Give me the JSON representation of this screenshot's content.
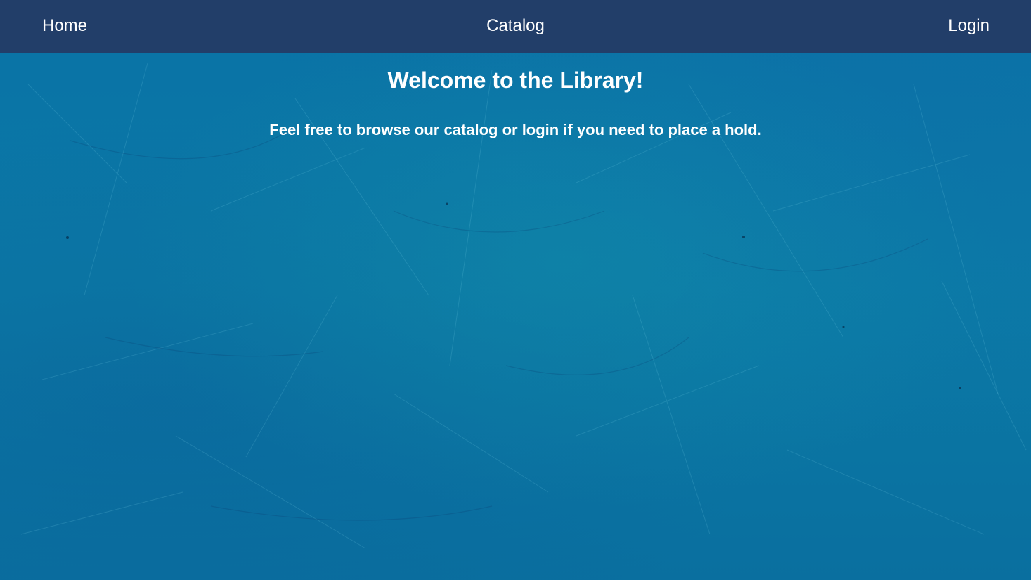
{
  "nav": {
    "home_label": "Home",
    "catalog_label": "Catalog",
    "login_label": "Login"
  },
  "main": {
    "heading": "Welcome to the Library!",
    "subtitle": "Feel free to browse our catalog or login if you need to place a hold."
  },
  "colors": {
    "navbar": "#223e69",
    "background": "#0a6e9e",
    "text": "#ffffff"
  }
}
